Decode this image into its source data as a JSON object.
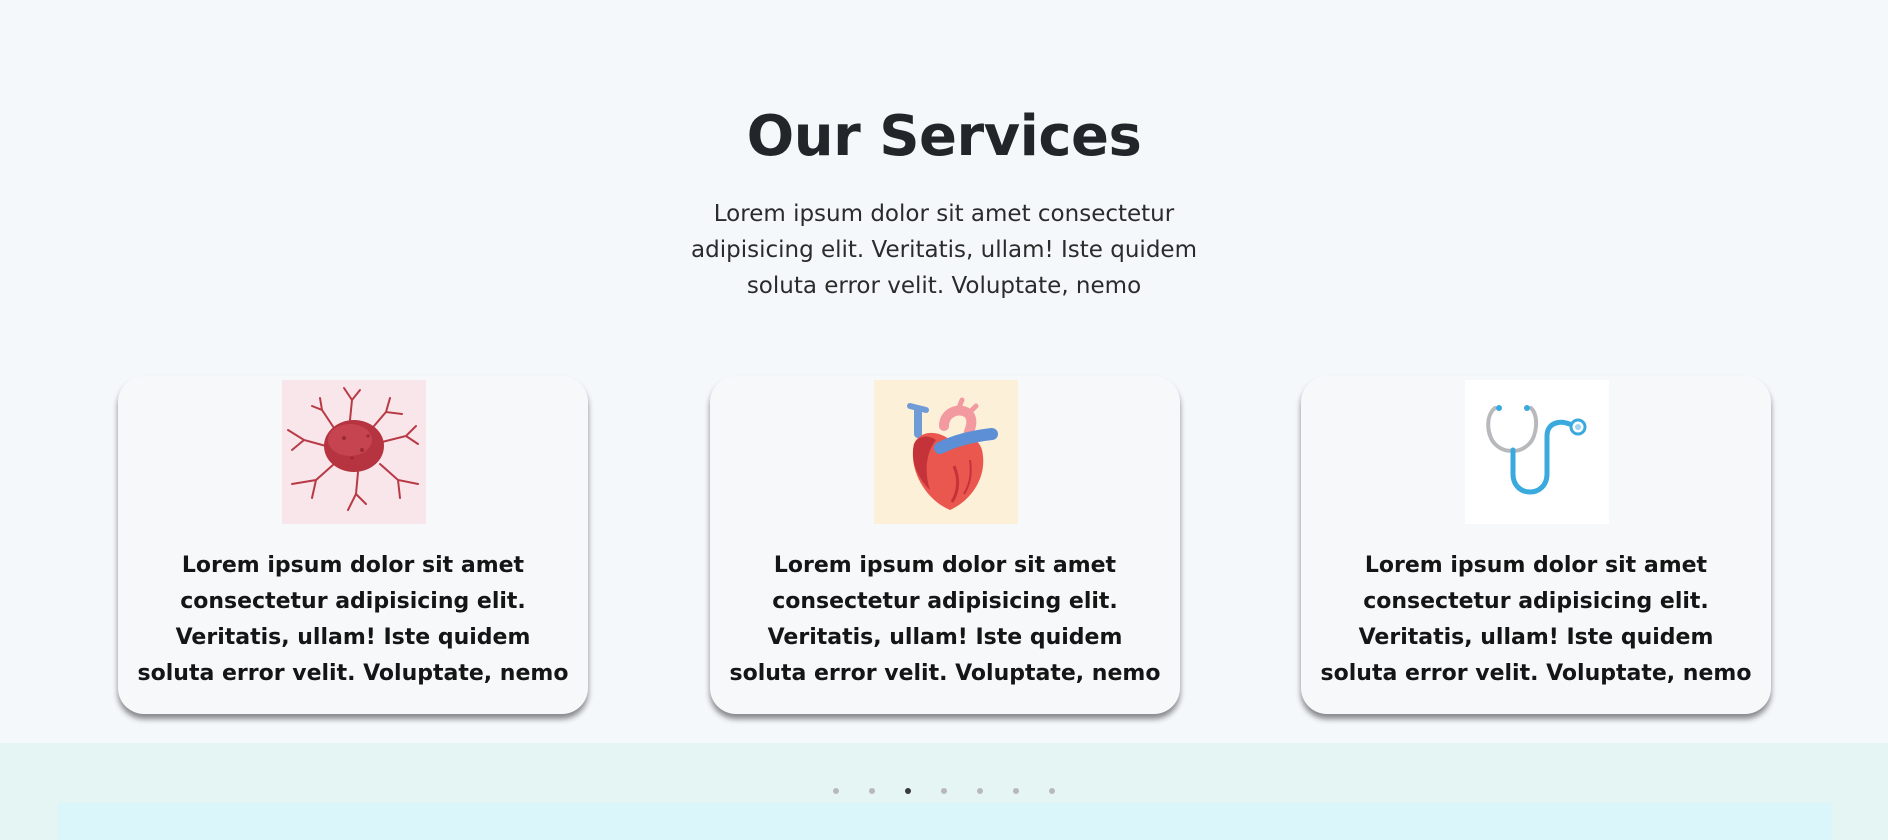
{
  "services": {
    "title": "Our Services",
    "subtitle": "Lorem ipsum dolor sit amet consectetur adipisicing elit. Veritatis, ullam! Iste quidem soluta error velit. Voluptate, nemo",
    "cards": [
      {
        "image": "tumor-cell-icon",
        "text": "Lorem ipsum dolor sit amet consectetur adipisicing elit. Veritatis, ullam! Iste quidem soluta error velit. Voluptate, nemo"
      },
      {
        "image": "heart-icon",
        "text": "Lorem ipsum dolor sit amet consectetur adipisicing elit. Veritatis, ullam! Iste quidem soluta error velit. Voluptate, nemo"
      },
      {
        "image": "stethoscope-icon",
        "text": "Lorem ipsum dolor sit amet consectetur adipisicing elit. Veritatis, ullam! Iste quidem soluta error velit. Voluptate, nemo"
      }
    ]
  },
  "carousel": {
    "dot_count": 7,
    "active_index": 2
  },
  "colors": {
    "page_bg": "#f4f8fb",
    "band_bg": "#e4f5f4",
    "strip_bg": "#daf6fb",
    "active_dot": "#3a3a3a",
    "inactive_dot": "#b9b9b9"
  }
}
